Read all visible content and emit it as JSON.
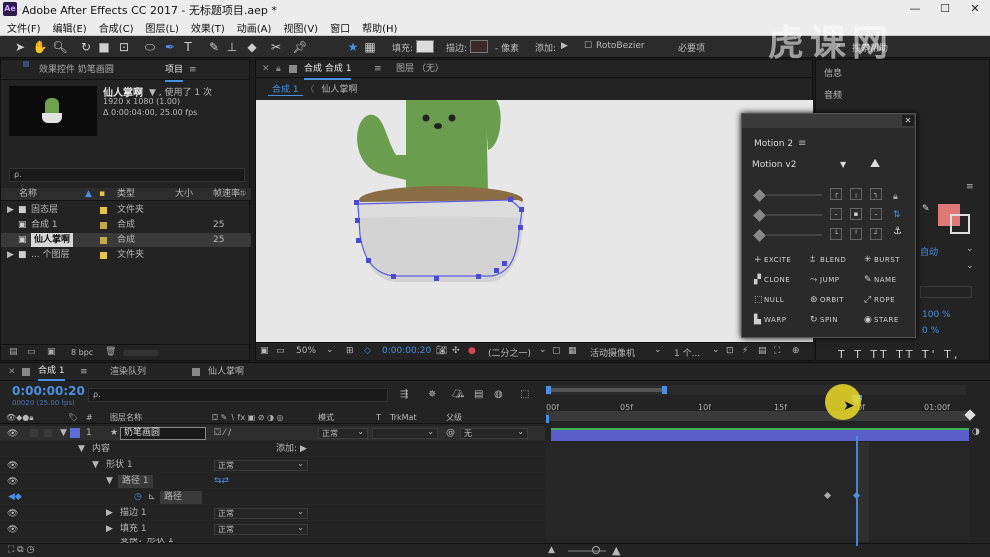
{
  "titlebar": {
    "app_icon": "Ae",
    "title": "Adobe After Effects CC 2017 - 无标题项目.aep *",
    "minimize": "—",
    "maximize": "☐",
    "close": "✕"
  },
  "menu": [
    "文件(F)",
    "编辑(E)",
    "合成(C)",
    "图层(L)",
    "效果(T)",
    "动画(A)",
    "视图(V)",
    "窗口",
    "帮助(H)"
  ],
  "toolbar": {
    "fill_label": "填充:",
    "stroke_label": "描边:",
    "stroke_px": "- 像素",
    "add_label": "添加:",
    "rotobezier": "RotoBezier",
    "workspace": "必要项",
    "search_placeholder": "搜索帮助",
    "fill_color": "#dcdcdc",
    "stroke_color": "#d94a4a"
  },
  "project_panel": {
    "tab_effects": "效果控件 奶笔画圆",
    "tab_project": "项目",
    "item_name": "仙人掌啊",
    "item_usage": "▼ , 使用了 1 次",
    "item_res": "1920 x 1080 (1.00)",
    "item_duration": "Δ 0:00:04:00, 25.00 fps",
    "search_placeholder": "ρ.",
    "columns": [
      "名称",
      "类型",
      "大小",
      "帧速率"
    ],
    "rows": [
      {
        "name": "固态层",
        "type": "文件夹",
        "size": "",
        "fps": "",
        "label_color": "#e8c34a",
        "icon": "folder-icon"
      },
      {
        "name": "合成 1",
        "type": "合成",
        "size": "",
        "fps": "25",
        "label_color": "#c7a64c",
        "icon": "comp-icon"
      },
      {
        "name": "仙人掌啊",
        "type": "合成",
        "size": "",
        "fps": "25",
        "label_color": "#c7a64c",
        "icon": "comp-icon"
      },
      {
        "name": "... 个图层",
        "type": "文件夹",
        "size": "",
        "fps": "",
        "label_color": "#e8c34a",
        "icon": "folder-icon"
      }
    ],
    "bpc": "8 bpc"
  },
  "comp_panel": {
    "tab_comp": "合成 合成 1",
    "tab_layer": "图层 （无）",
    "breadcrumb_1": "合成 1",
    "breadcrumb_2": "仙人掌啊",
    "zoom": "50%",
    "timecode": "0:00:00:20",
    "resolution": "(二分之一)",
    "camera": "活动摄像机",
    "views": "1 个...",
    "bg_color": "#e6e7e6"
  },
  "motion_panel": {
    "title": "Motion 2",
    "version": "Motion v2",
    "buttons": [
      {
        "icon": "plus-icon",
        "glyph": "+",
        "label": "EXCITE"
      },
      {
        "icon": "blend-icon",
        "glyph": "⩲",
        "label": "BLEND"
      },
      {
        "icon": "burst-icon",
        "glyph": "✳",
        "label": "BURST"
      },
      {
        "icon": "clone-icon",
        "glyph": "▞",
        "label": "CLONE"
      },
      {
        "icon": "jump-icon",
        "glyph": "⤳",
        "label": "JUMP"
      },
      {
        "icon": "name-icon",
        "glyph": "✎",
        "label": "NAME"
      },
      {
        "icon": "null-icon",
        "glyph": "⬚",
        "label": "NULL"
      },
      {
        "icon": "orbit-icon",
        "glyph": "⊛",
        "label": "ORBIT"
      },
      {
        "icon": "rope-icon",
        "glyph": "⤢",
        "label": "ROPE"
      },
      {
        "icon": "warp-icon",
        "glyph": "▙",
        "label": "WARP"
      },
      {
        "icon": "spin-icon",
        "glyph": "↻",
        "label": "SPIN"
      },
      {
        "icon": "stare-icon",
        "glyph": "◉",
        "label": "STARE"
      }
    ]
  },
  "right_panel": {
    "info": "信息",
    "audio": "音频",
    "auto": "自动",
    "pct1": "100 %",
    "pct2": "0 %",
    "type_glyphs": "T T TT TT T' T,"
  },
  "watermark": "虎课网",
  "timeline": {
    "tab_comp": "合成 1",
    "tab_render": "渲染队列",
    "tab_cactus": "仙人掌啊",
    "timecode": "0:00:00:20",
    "timecode_sub": "00020 (25.00 fps)",
    "search_placeholder": "ρ.",
    "col_name": "图层名称",
    "col_mode": "模式",
    "col_t": "T",
    "col_trkmat": "TrkMat",
    "col_parent": "父级",
    "layer_num": "1",
    "layer_name": "奶笔画圆",
    "layer_mode": "正常",
    "layer_parent": "无",
    "layer_label_color": "#5a6fd6",
    "rows": [
      {
        "indent": 1,
        "label": "内容",
        "value": "",
        "add": "添加:"
      },
      {
        "indent": 2,
        "label": "形状 1",
        "value": "正常"
      },
      {
        "indent": 3,
        "label": "路径 1",
        "value": ""
      },
      {
        "indent": 4,
        "label": "路径",
        "value": ""
      },
      {
        "indent": 3,
        "label": "描边 1",
        "value": "正常"
      },
      {
        "indent": 3,
        "label": "填充 1",
        "value": "正常"
      },
      {
        "indent": 3,
        "label": "变换：形状 1",
        "value": ""
      }
    ],
    "ruler": [
      "00f",
      "05f",
      "10f",
      "15f",
      "20f",
      "01:00f"
    ]
  }
}
